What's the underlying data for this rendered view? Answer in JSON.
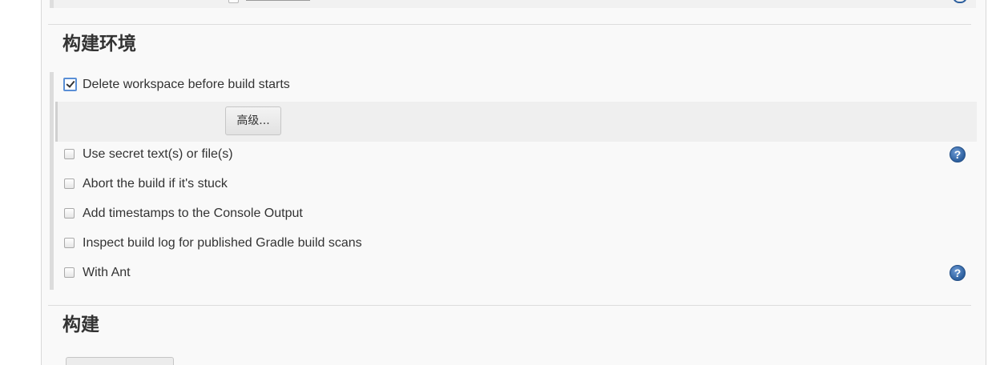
{
  "sections": {
    "build_env": {
      "title": "构建环境"
    },
    "build": {
      "title": "构建"
    }
  },
  "options": [
    {
      "key": "delete_workspace",
      "label": "Delete workspace before build starts",
      "checked": true,
      "help": false
    },
    {
      "key": "secret_text",
      "label": "Use secret text(s) or file(s)",
      "checked": false,
      "help": true
    },
    {
      "key": "abort_stuck",
      "label": "Abort the build if it's stuck",
      "checked": false,
      "help": false
    },
    {
      "key": "timestamps",
      "label": "Add timestamps to the Console Output",
      "checked": false,
      "help": false
    },
    {
      "key": "gradle_scans",
      "label": "Inspect build log for published Gradle build scans",
      "checked": false,
      "help": false
    },
    {
      "key": "with_ant",
      "label": "With Ant",
      "checked": false,
      "help": true
    }
  ],
  "advanced_button": {
    "label": "高级..."
  },
  "help_icon": {
    "glyph": "?",
    "icon": "help-icon",
    "color": "#2c5f9e"
  },
  "colors": {
    "panel_bg": "#f9f9f9",
    "group_bar": "#dcdcdc",
    "advanced_row_bg": "#efefef",
    "checkbox_focus": "#5a8fd6"
  }
}
